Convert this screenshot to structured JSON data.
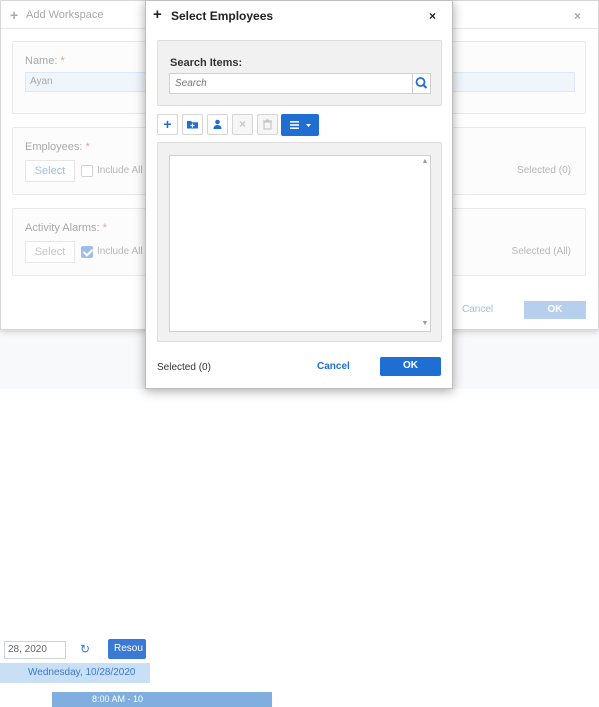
{
  "background": {
    "date_input_value": "28, 2020",
    "today_button_label": "Resou",
    "day_header": "Wednesday, 10/28/2020",
    "time_slot": "8:00 AM - 10"
  },
  "workspace_dialog": {
    "title": "Add Workspace",
    "name_label": "Name:",
    "name_value": "Ayan",
    "required_mark": "*",
    "employees_label": "Employees:",
    "employees_select_label": "Select",
    "employees_include_all": "Include All",
    "employees_include_all_checked": false,
    "employees_selected": "Selected (0)",
    "alarms_label": "Activity Alarms:",
    "alarms_select_label": "Select",
    "alarms_include_all": "Include All",
    "alarms_include_all_checked": true,
    "alarms_selected": "Selected (All)",
    "cancel_label": "Cancel",
    "ok_label": "OK"
  },
  "select_employees_modal": {
    "title": "Select Employees",
    "close_glyph": "×",
    "search_label": "Search Items:",
    "search_placeholder": "Search",
    "toolbar": [
      {
        "name": "add-icon",
        "enabled": true
      },
      {
        "name": "add-folder-icon",
        "enabled": true
      },
      {
        "name": "user-icon",
        "enabled": true
      },
      {
        "name": "remove-icon",
        "enabled": false
      },
      {
        "name": "trash-icon",
        "enabled": false
      }
    ],
    "view_menu_icon": "list-icon",
    "selected_count": "Selected (0)",
    "cancel_label": "Cancel",
    "ok_label": "OK"
  },
  "colors": {
    "accent": "#1f6fd2",
    "accent_light": "#a9c7ea",
    "required": "#f08a8a"
  }
}
